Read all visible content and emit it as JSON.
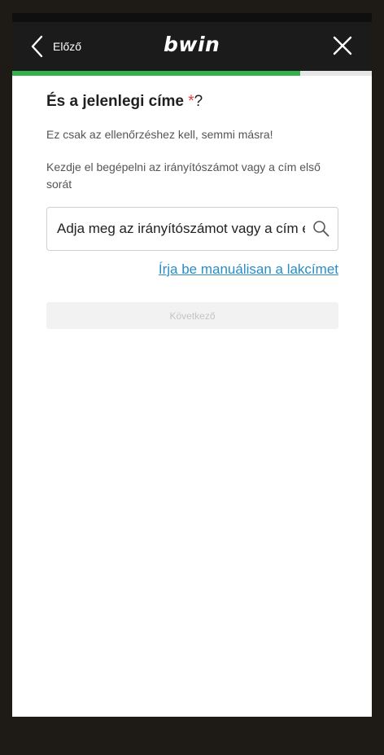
{
  "header": {
    "back_label": "Előző",
    "logo_text": "bwin"
  },
  "progress": {
    "fraction": 0.8,
    "color": "#33b24a"
  },
  "form": {
    "title": "És a jelenlegi címe ",
    "required_mark": "*",
    "title_suffix": "?",
    "subtitle": "Ez csak az ellenőrzéshez kell, semmi másra!",
    "helper": "Kezdje el begépelni az irányítószámot vagy a cím első sorát",
    "search_placeholder": "Adja meg az irányítószámot vagy a cím első sorát",
    "manual_link": "Írja be manuálisan a lakcímet",
    "next_button": "Következő"
  },
  "colors": {
    "accent_link": "#2b8cc4",
    "required": "#e03b3b",
    "header_bg": "#1b1b1b"
  }
}
